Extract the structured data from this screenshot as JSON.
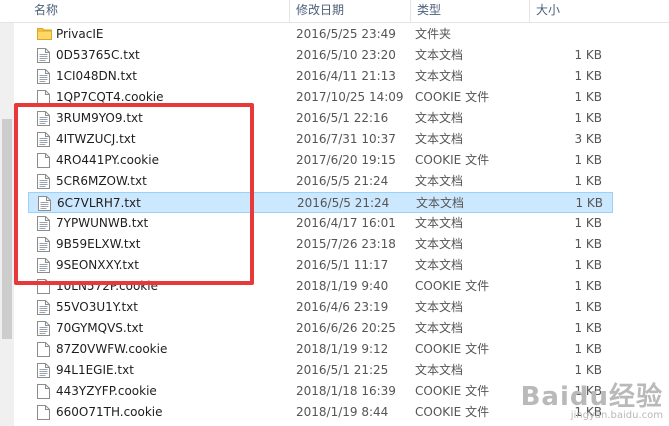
{
  "header": {
    "name_label": "名称",
    "date_label": "修改日期",
    "type_label": "类型",
    "size_label": "大小"
  },
  "rows": [
    {
      "name": "PrivacIE",
      "date": "2016/5/25 23:49",
      "type": "文件夹",
      "size": "",
      "icon": "folder-icon"
    },
    {
      "name": "0D53765C.txt",
      "date": "2016/5/10 23:20",
      "type": "文本文档",
      "size": "1 KB",
      "icon": "text-file-icon"
    },
    {
      "name": "1CI048DN.txt",
      "date": "2016/4/11 21:13",
      "type": "文本文档",
      "size": "1 KB",
      "icon": "text-file-icon"
    },
    {
      "name": "1QP7CQT4.cookie",
      "date": "2017/10/25 14:09",
      "type": "COOKIE 文件",
      "size": "1 KB",
      "icon": "file-icon"
    },
    {
      "name": "3RUM9YO9.txt",
      "date": "2016/5/1 22:16",
      "type": "文本文档",
      "size": "1 KB",
      "icon": "text-file-icon"
    },
    {
      "name": "4ITWZUCJ.txt",
      "date": "2016/7/31 10:37",
      "type": "文本文档",
      "size": "3 KB",
      "icon": "text-file-icon"
    },
    {
      "name": "4RO441PY.cookie",
      "date": "2017/6/20 19:15",
      "type": "COOKIE 文件",
      "size": "1 KB",
      "icon": "file-icon"
    },
    {
      "name": "5CR6MZOW.txt",
      "date": "2016/5/5 21:24",
      "type": "文本文档",
      "size": "1 KB",
      "icon": "text-file-icon"
    },
    {
      "name": "6C7VLRH7.txt",
      "date": "2016/5/5 21:24",
      "type": "文本文档",
      "size": "1 KB",
      "icon": "text-file-icon",
      "selected": true
    },
    {
      "name": "7YPWUNWB.txt",
      "date": "2016/4/17 16:01",
      "type": "文本文档",
      "size": "1 KB",
      "icon": "text-file-icon"
    },
    {
      "name": "9B59ELXW.txt",
      "date": "2015/7/26 23:18",
      "type": "文本文档",
      "size": "1 KB",
      "icon": "text-file-icon"
    },
    {
      "name": "9SEONXXY.txt",
      "date": "2016/5/1 11:17",
      "type": "文本文档",
      "size": "1 KB",
      "icon": "text-file-icon"
    },
    {
      "name": "10LN572P.cookie",
      "date": "2018/1/19 9:40",
      "type": "COOKIE 文件",
      "size": "1 KB",
      "icon": "file-icon"
    },
    {
      "name": "55VO3U1Y.txt",
      "date": "2016/4/6 23:19",
      "type": "文本文档",
      "size": "1 KB",
      "icon": "text-file-icon"
    },
    {
      "name": "70GYMQVS.txt",
      "date": "2016/6/26 20:25",
      "type": "文本文档",
      "size": "1 KB",
      "icon": "text-file-icon"
    },
    {
      "name": "87Z0VWFW.cookie",
      "date": "2018/1/19 9:12",
      "type": "COOKIE 文件",
      "size": "1 KB",
      "icon": "file-icon"
    },
    {
      "name": "94L1EGIE.txt",
      "date": "2016/5/1 21:25",
      "type": "文本文档",
      "size": "1 KB",
      "icon": "text-file-icon"
    },
    {
      "name": "443YZYFP.cookie",
      "date": "2018/1/18 16:39",
      "type": "COOKIE 文件",
      "size": "1 KB",
      "icon": "file-icon"
    },
    {
      "name": "660O71TH.cookie",
      "date": "2018/1/19 8:44",
      "type": "COOKIE 文件",
      "size": "1 KB",
      "icon": "file-icon"
    }
  ],
  "watermark": {
    "main": "Baidu经验",
    "sub": "jingyan.baidu.com"
  },
  "colors": {
    "selection_bg": "#cce8ff",
    "selection_border": "#99d1ff",
    "highlight_box": "#e8393a",
    "header_text": "#4c607a"
  }
}
